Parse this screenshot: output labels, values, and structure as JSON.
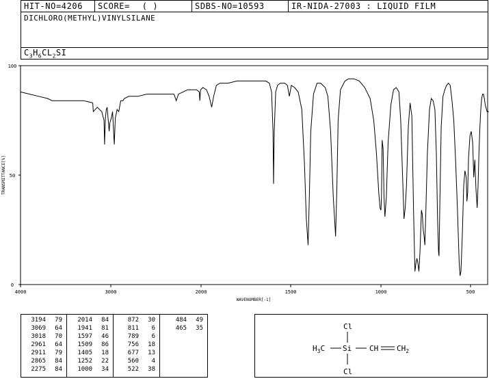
{
  "header": {
    "hit_no": "HIT-NO=4206",
    "score_label": "SCORE=",
    "score_value": "(   )",
    "sdbs_no": "SDBS-NO=10593",
    "ir_info": "IR-NIDA-27003 : LIQUID FILM",
    "compound_name": "DICHLORO(METHYL)VINYLSILANE",
    "formula_parts": [
      "C",
      "3",
      "H",
      "6",
      "CL",
      "2",
      "SI"
    ]
  },
  "peak_table": [
    [
      [
        "3194",
        "79"
      ],
      [
        "3069",
        "64"
      ],
      [
        "3018",
        "70"
      ],
      [
        "2961",
        "64"
      ],
      [
        "2911",
        "79"
      ],
      [
        "2865",
        "84"
      ],
      [
        "2275",
        "84"
      ]
    ],
    [
      [
        "2014",
        "84"
      ],
      [
        "1941",
        "81"
      ],
      [
        "1597",
        "46"
      ],
      [
        "1509",
        "86"
      ],
      [
        "1405",
        "18"
      ],
      [
        "1252",
        "22"
      ],
      [
        "1000",
        "34"
      ]
    ],
    [
      [
        "872",
        "30"
      ],
      [
        "811",
        "6"
      ],
      [
        "789",
        "6"
      ],
      [
        "756",
        "18"
      ],
      [
        "677",
        "13"
      ],
      [
        "560",
        "4"
      ],
      [
        "522",
        "38"
      ]
    ],
    [
      [
        "484",
        "49"
      ],
      [
        "465",
        "35"
      ]
    ]
  ],
  "structure": {
    "top_atom": "Cl",
    "bottom_atom": "Cl",
    "center_atom": "Si",
    "left_group_main": "H",
    "left_group_sub": "3",
    "left_group_tail": "C",
    "vinyl_ch": "CH",
    "vinyl_ch2_main": "CH",
    "vinyl_ch2_sub": "2"
  },
  "chart_data": {
    "type": "line",
    "title": "",
    "xlabel": "WAVENUMBER[-1]",
    "ylabel": "TRANSMITTANCE[%]",
    "xlim": [
      4000,
      400
    ],
    "ylim": [
      0,
      100
    ],
    "x_ticks": [
      4000,
      3000,
      2000,
      1500,
      1000,
      500
    ],
    "y_ticks": [
      0,
      50,
      100
    ],
    "x_tick_labels": [
      "4000",
      "3000",
      "2000",
      "1500",
      "1000",
      "500"
    ],
    "y_tick_labels": [
      "0",
      "50",
      "100"
    ],
    "series": [
      {
        "points": [
          [
            4000,
            88
          ],
          [
            3900,
            87
          ],
          [
            3800,
            86
          ],
          [
            3700,
            85
          ],
          [
            3650,
            84
          ],
          [
            3600,
            84
          ],
          [
            3500,
            84
          ],
          [
            3400,
            84
          ],
          [
            3300,
            84
          ],
          [
            3200,
            83
          ],
          [
            3194,
            79
          ],
          [
            3150,
            81
          ],
          [
            3100,
            79
          ],
          [
            3075,
            75
          ],
          [
            3069,
            64
          ],
          [
            3060,
            76
          ],
          [
            3050,
            80
          ],
          [
            3040,
            81
          ],
          [
            3030,
            76
          ],
          [
            3018,
            70
          ],
          [
            3010,
            74
          ],
          [
            2995,
            76
          ],
          [
            2980,
            79
          ],
          [
            2961,
            64
          ],
          [
            2950,
            76
          ],
          [
            2930,
            80
          ],
          [
            2911,
            79
          ],
          [
            2890,
            84
          ],
          [
            2865,
            84
          ],
          [
            2850,
            85
          ],
          [
            2800,
            86
          ],
          [
            2700,
            86
          ],
          [
            2600,
            87
          ],
          [
            2500,
            87
          ],
          [
            2400,
            87
          ],
          [
            2300,
            87
          ],
          [
            2275,
            84
          ],
          [
            2250,
            87
          ],
          [
            2200,
            88
          ],
          [
            2150,
            89
          ],
          [
            2100,
            89
          ],
          [
            2050,
            89
          ],
          [
            2020,
            88
          ],
          [
            2014,
            84
          ],
          [
            2005,
            89
          ],
          [
            1990,
            90
          ],
          [
            1970,
            89
          ],
          [
            1955,
            86
          ],
          [
            1941,
            81
          ],
          [
            1930,
            86
          ],
          [
            1915,
            91
          ],
          [
            1895,
            92
          ],
          [
            1850,
            92
          ],
          [
            1800,
            93
          ],
          [
            1750,
            93
          ],
          [
            1700,
            93
          ],
          [
            1660,
            93
          ],
          [
            1640,
            93
          ],
          [
            1620,
            92
          ],
          [
            1608,
            88
          ],
          [
            1600,
            70
          ],
          [
            1597,
            46
          ],
          [
            1593,
            70
          ],
          [
            1585,
            88
          ],
          [
            1575,
            91
          ],
          [
            1560,
            92
          ],
          [
            1535,
            92
          ],
          [
            1520,
            91
          ],
          [
            1509,
            86
          ],
          [
            1498,
            91
          ],
          [
            1480,
            90
          ],
          [
            1460,
            88
          ],
          [
            1440,
            80
          ],
          [
            1425,
            55
          ],
          [
            1415,
            30
          ],
          [
            1405,
            18
          ],
          [
            1398,
            40
          ],
          [
            1390,
            70
          ],
          [
            1375,
            87
          ],
          [
            1355,
            92
          ],
          [
            1335,
            92
          ],
          [
            1310,
            90
          ],
          [
            1295,
            86
          ],
          [
            1280,
            70
          ],
          [
            1265,
            40
          ],
          [
            1252,
            22
          ],
          [
            1245,
            45
          ],
          [
            1238,
            75
          ],
          [
            1225,
            89
          ],
          [
            1200,
            93
          ],
          [
            1180,
            94
          ],
          [
            1150,
            94
          ],
          [
            1120,
            93
          ],
          [
            1090,
            90
          ],
          [
            1060,
            85
          ],
          [
            1040,
            75
          ],
          [
            1025,
            60
          ],
          [
            1012,
            42
          ],
          [
            1005,
            35
          ],
          [
            1000,
            34
          ],
          [
            997,
            40
          ],
          [
            993,
            66
          ],
          [
            988,
            62
          ],
          [
            983,
            40
          ],
          [
            978,
            31
          ],
          [
            970,
            40
          ],
          [
            960,
            65
          ],
          [
            945,
            82
          ],
          [
            930,
            89
          ],
          [
            915,
            90
          ],
          [
            900,
            88
          ],
          [
            890,
            75
          ],
          [
            880,
            50
          ],
          [
            872,
            30
          ],
          [
            865,
            35
          ],
          [
            858,
            45
          ],
          [
            848,
            72
          ],
          [
            838,
            83
          ],
          [
            828,
            77
          ],
          [
            819,
            35
          ],
          [
            811,
            6
          ],
          [
            805,
            10
          ],
          [
            800,
            12
          ],
          [
            795,
            10
          ],
          [
            789,
            6
          ],
          [
            783,
            15
          ],
          [
            775,
            34
          ],
          [
            770,
            32
          ],
          [
            765,
            25
          ],
          [
            760,
            22
          ],
          [
            756,
            18
          ],
          [
            750,
            35
          ],
          [
            742,
            60
          ],
          [
            730,
            80
          ],
          [
            720,
            85
          ],
          [
            710,
            84
          ],
          [
            700,
            80
          ],
          [
            692,
            60
          ],
          [
            685,
            30
          ],
          [
            680,
            15
          ],
          [
            677,
            13
          ],
          [
            672,
            40
          ],
          [
            665,
            72
          ],
          [
            655,
            86
          ],
          [
            645,
            89
          ],
          [
            635,
            91
          ],
          [
            625,
            92
          ],
          [
            615,
            91
          ],
          [
            605,
            84
          ],
          [
            595,
            75
          ],
          [
            585,
            57
          ],
          [
            575,
            35
          ],
          [
            565,
            10
          ],
          [
            560,
            4
          ],
          [
            555,
            6
          ],
          [
            548,
            22
          ],
          [
            540,
            45
          ],
          [
            533,
            52
          ],
          [
            526,
            49
          ],
          [
            522,
            38
          ],
          [
            518,
            42
          ],
          [
            513,
            58
          ],
          [
            505,
            68
          ],
          [
            498,
            70
          ],
          [
            490,
            65
          ],
          [
            484,
            49
          ],
          [
            478,
            57
          ],
          [
            472,
            44
          ],
          [
            465,
            35
          ],
          [
            460,
            45
          ],
          [
            455,
            60
          ],
          [
            450,
            72
          ],
          [
            445,
            80
          ],
          [
            440,
            85
          ],
          [
            435,
            87
          ],
          [
            430,
            87
          ],
          [
            425,
            85
          ],
          [
            420,
            82
          ],
          [
            410,
            79
          ],
          [
            400,
            79
          ]
        ]
      }
    ]
  }
}
